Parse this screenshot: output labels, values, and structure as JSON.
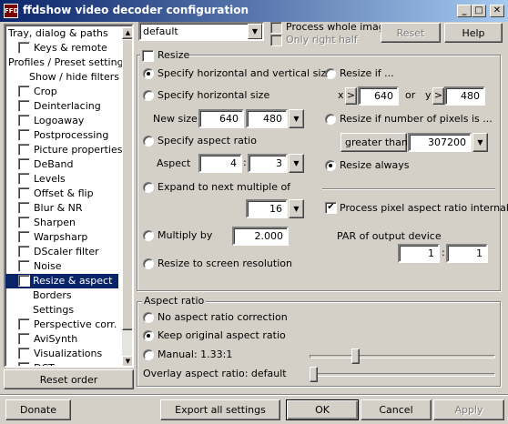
{
  "window": {
    "title": "ffdshow video decoder configuration",
    "icon_text": "FFD",
    "buttons": {
      "minimize": "_",
      "maximize": "□",
      "close": "✕"
    }
  },
  "tree": {
    "items": [
      {
        "label": "Tray, dialog & paths",
        "checkbox": false,
        "indent": 0
      },
      {
        "label": "Keys & remote",
        "checkbox": true,
        "indent": 1
      },
      {
        "label": "Profiles / Preset settings",
        "checkbox": false,
        "indent": 0
      },
      {
        "label": "Show / hide filters",
        "checkbox": false,
        "indent": 2
      },
      {
        "label": "Crop",
        "checkbox": true,
        "indent": 1
      },
      {
        "label": "Deinterlacing",
        "checkbox": true,
        "indent": 1
      },
      {
        "label": "Logoaway",
        "checkbox": true,
        "indent": 1
      },
      {
        "label": "Postprocessing",
        "checkbox": true,
        "indent": 1
      },
      {
        "label": "Picture properties",
        "checkbox": true,
        "indent": 1
      },
      {
        "label": "DeBand",
        "checkbox": true,
        "indent": 1
      },
      {
        "label": "Levels",
        "checkbox": true,
        "indent": 1
      },
      {
        "label": "Offset & flip",
        "checkbox": true,
        "indent": 1
      },
      {
        "label": "Blur & NR",
        "checkbox": true,
        "indent": 1
      },
      {
        "label": "Sharpen",
        "checkbox": true,
        "indent": 1
      },
      {
        "label": "Warpsharp",
        "checkbox": true,
        "indent": 1
      },
      {
        "label": "DScaler filter",
        "checkbox": true,
        "indent": 1
      },
      {
        "label": "Noise",
        "checkbox": true,
        "indent": 1
      },
      {
        "label": "Resize & aspect",
        "checkbox": true,
        "indent": 1,
        "selected": true
      },
      {
        "label": "Borders",
        "checkbox": false,
        "indent": 3
      },
      {
        "label": "Settings",
        "checkbox": false,
        "indent": 3
      },
      {
        "label": "Perspective corr.",
        "checkbox": true,
        "indent": 1
      },
      {
        "label": "AviSynth",
        "checkbox": true,
        "indent": 1
      },
      {
        "label": "Visualizations",
        "checkbox": true,
        "indent": 1
      },
      {
        "label": "DCT",
        "checkbox": true,
        "indent": 1
      }
    ],
    "reset_order": "Reset order"
  },
  "top": {
    "preset": "default",
    "process_whole_image": "Process whole image",
    "only_right_half": "Only right half",
    "reset": "Reset",
    "help": "Help"
  },
  "resize": {
    "title": "Resize",
    "specify_hv": "Specify horizontal and vertical size",
    "specify_h": "Specify horizontal size",
    "new_size": "New size",
    "new_w": "640",
    "new_h": "480",
    "specify_aspect": "Specify aspect ratio",
    "aspect": "Aspect",
    "aspect_num": "4",
    "aspect_den": "3",
    "colon": ":",
    "expand": "Expand to next multiple of",
    "multiple": "16",
    "multiply_by": "Multiply by",
    "multiply_val": "2.000",
    "resize_screen": "Resize to screen resolution",
    "resize_if": "Resize if ...",
    "x_label": "x",
    "y_label": "y",
    "gt": ">",
    "or": "or",
    "if_x": "640",
    "if_y": "480",
    "resize_pixels": "Resize if number of pixels is ...",
    "greater_than": "greater than",
    "pixels": "307200",
    "resize_always": "Resize always",
    "process_par": "Process pixel aspect ratio internally",
    "par_output": "PAR of output device",
    "par_num": "1",
    "par_den": "1"
  },
  "aspect_ratio": {
    "title": "Aspect ratio",
    "no_correction": "No aspect ratio correction",
    "keep_original": "Keep original aspect ratio",
    "manual": "Manual: 1.33:1",
    "overlay": "Overlay aspect ratio: default"
  },
  "bottom": {
    "donate": "Donate",
    "export": "Export all settings",
    "ok": "OK",
    "cancel": "Cancel",
    "apply": "Apply"
  }
}
